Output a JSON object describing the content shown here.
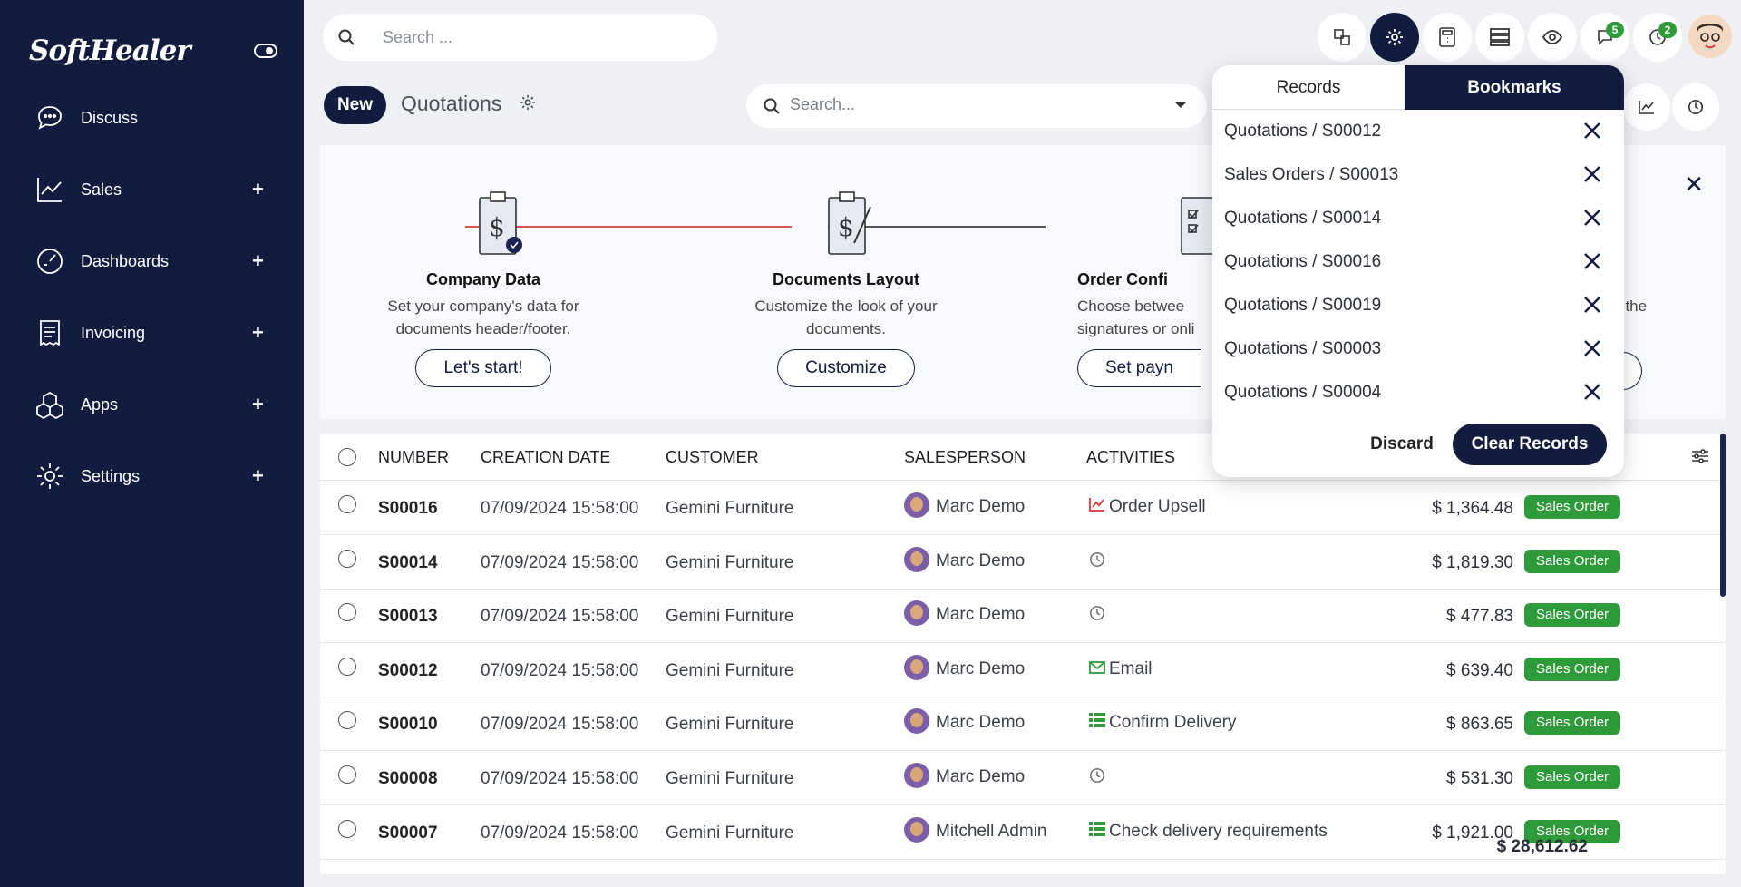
{
  "app": {
    "logo_text": "SoftHealer"
  },
  "sidebar": {
    "items": [
      {
        "label": "Discuss",
        "icon": "chat-icon",
        "expandable": false
      },
      {
        "label": "Sales",
        "icon": "trend-chart-icon",
        "expandable": true
      },
      {
        "label": "Dashboards",
        "icon": "gauge-icon",
        "expandable": true
      },
      {
        "label": "Invoicing",
        "icon": "receipt-icon",
        "expandable": true
      },
      {
        "label": "Apps",
        "icon": "cubes-icon",
        "expandable": true
      },
      {
        "label": "Settings",
        "icon": "gear-icon",
        "expandable": true
      }
    ],
    "plus": "+"
  },
  "topbar": {
    "search_placeholder": "Search ...",
    "messages_count": "5",
    "activities_count": "2"
  },
  "control": {
    "new_label": "New",
    "breadcrumb": "Quotations",
    "search_placeholder": "Search..."
  },
  "onboarding": {
    "close": "✕",
    "steps": [
      {
        "title": "Company Data",
        "desc": "Set your company's data for documents header/footer.",
        "cta": "Let's start!"
      },
      {
        "title": "Documents Layout",
        "desc": "Customize the look of your documents.",
        "cta": "Customize"
      },
      {
        "title": "Order Confi",
        "desc": "Choose betwee signatures or onli",
        "cta": "Set payn"
      },
      {
        "title": "",
        "desc": "t the",
        "cta": ""
      }
    ]
  },
  "table": {
    "headers": {
      "number": "NUMBER",
      "creation_date": "CREATION DATE",
      "customer": "CUSTOMER",
      "salesperson": "SALESPERSON",
      "activities": "ACTIVITIES"
    },
    "rows": [
      {
        "number": "S00016",
        "date": "07/09/2024 15:58:00",
        "customer": "Gemini Furniture",
        "salesperson": "Marc Demo",
        "activity": "Order Upsell",
        "activity_icon": "trend-icon",
        "amount": "$ 1,364.48",
        "status": "Sales Order"
      },
      {
        "number": "S00014",
        "date": "07/09/2024 15:58:00",
        "customer": "Gemini Furniture",
        "salesperson": "Marc Demo",
        "activity": "",
        "activity_icon": "clock-icon",
        "amount": "$ 1,819.30",
        "status": "Sales Order"
      },
      {
        "number": "S00013",
        "date": "07/09/2024 15:58:00",
        "customer": "Gemini Furniture",
        "salesperson": "Marc Demo",
        "activity": "",
        "activity_icon": "clock-icon",
        "amount": "$ 477.83",
        "status": "Sales Order"
      },
      {
        "number": "S00012",
        "date": "07/09/2024 15:58:00",
        "customer": "Gemini Furniture",
        "salesperson": "Marc Demo",
        "activity": "Email",
        "activity_icon": "email-icon",
        "amount": "$ 639.40",
        "status": "Sales Order"
      },
      {
        "number": "S00010",
        "date": "07/09/2024 15:58:00",
        "customer": "Gemini Furniture",
        "salesperson": "Marc Demo",
        "activity": "Confirm Delivery",
        "activity_icon": "list-icon",
        "amount": "$ 863.65",
        "status": "Sales Order"
      },
      {
        "number": "S00008",
        "date": "07/09/2024 15:58:00",
        "customer": "Gemini Furniture",
        "salesperson": "Marc Demo",
        "activity": "",
        "activity_icon": "clock-icon",
        "amount": "$ 531.30",
        "status": "Sales Order"
      },
      {
        "number": "S00007",
        "date": "07/09/2024 15:58:00",
        "customer": "Gemini Furniture",
        "salesperson": "Mitchell Admin",
        "activity": "Check delivery requirements",
        "activity_icon": "list-icon",
        "amount": "$ 1,921.00",
        "status": "Sales Order"
      }
    ],
    "total": "$ 28,612.62"
  },
  "bookmarks_popover": {
    "tab_records": "Records",
    "tab_bookmarks": "Bookmarks",
    "items": [
      "Quotations / S00012",
      "Sales Orders / S00013",
      "Quotations / S00014",
      "Quotations / S00016",
      "Quotations / S00019",
      "Quotations / S00003",
      "Quotations / S00004"
    ],
    "discard_label": "Discard",
    "clear_label": "Clear Records"
  },
  "colors": {
    "sidebar": "#111c3f",
    "accent": "#111c3f",
    "status": "#2e9a3a"
  }
}
